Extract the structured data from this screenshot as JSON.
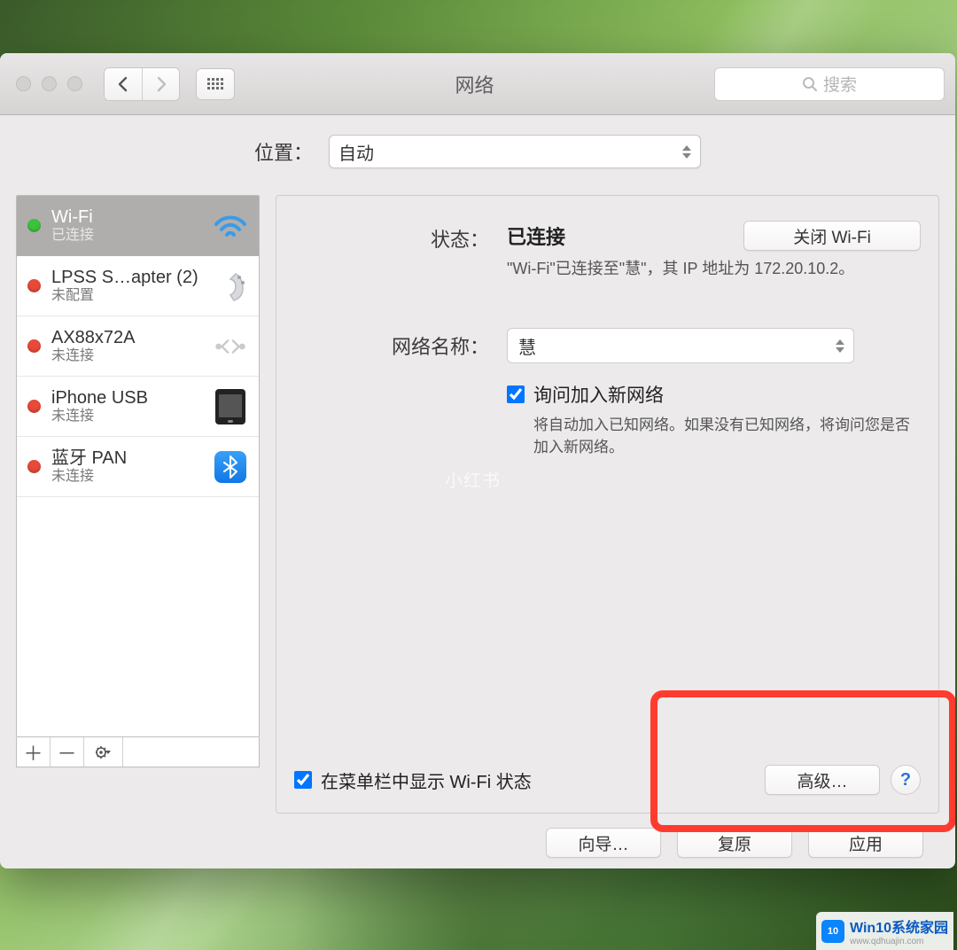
{
  "window": {
    "title": "网络",
    "search_placeholder": "搜索"
  },
  "location": {
    "label": "位置：",
    "value": "自动"
  },
  "services": [
    {
      "name": "Wi-Fi",
      "status": "已连接",
      "dot": "green",
      "icon": "wifi",
      "selected": true
    },
    {
      "name": "LPSS S…apter (2)",
      "status": "未配置",
      "dot": "red",
      "icon": "serial",
      "selected": false
    },
    {
      "name": "AX88x72A",
      "status": "未连接",
      "dot": "red",
      "icon": "ethernet",
      "selected": false
    },
    {
      "name": "iPhone USB",
      "status": "未连接",
      "dot": "red",
      "icon": "iphone",
      "selected": false
    },
    {
      "name": "蓝牙 PAN",
      "status": "未连接",
      "dot": "red",
      "icon": "bluetooth",
      "selected": false
    }
  ],
  "detail": {
    "status_label": "状态：",
    "status_value": "已连接",
    "turn_off_button": "关闭 Wi-Fi",
    "status_desc": "\"Wi-Fi\"已连接至\"慧\"，其 IP 地址为 172.20.10.2。",
    "network_name_label": "网络名称：",
    "network_name_value": "慧",
    "ask_join_label": "询问加入新网络",
    "ask_join_hint": "将自动加入已知网络。如果没有已知网络，将询问您是否加入新网络。",
    "show_in_menubar_label": "在菜单栏中显示 Wi-Fi 状态",
    "advanced_button": "高级…"
  },
  "footer": {
    "assist": "向导…",
    "revert": "复原",
    "apply": "应用"
  },
  "watermark": {
    "center": "小红书",
    "corner_text": "Win10系统家园",
    "corner_url": "www.qdhuajin.com",
    "badge": "10"
  }
}
